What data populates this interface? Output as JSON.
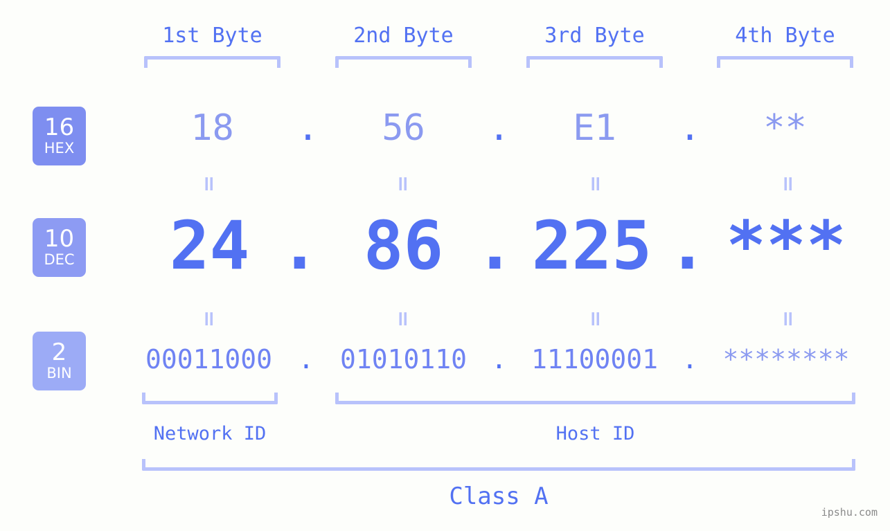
{
  "background_color": "#fdfefb",
  "accent_color": "#5271f2",
  "accent_light_color": "#8b9af0",
  "bracket_color": "#b8c2fb",
  "byte_headers": [
    {
      "label": "1st Byte"
    },
    {
      "label": "2nd Byte"
    },
    {
      "label": "3rd Byte"
    },
    {
      "label": "4th Byte"
    }
  ],
  "radix_badges": [
    {
      "number": "16",
      "word": "HEX",
      "color": "#7e8ef0"
    },
    {
      "number": "10",
      "word": "DEC",
      "color": "#8d9bf3"
    },
    {
      "number": "2",
      "word": "BIN",
      "color": "#9cabf6"
    }
  ],
  "rows": {
    "hex": {
      "radix": "16",
      "values": [
        "18",
        "56",
        "E1",
        "**"
      ],
      "separator": "."
    },
    "dec": {
      "radix": "10",
      "values": [
        "24",
        "86",
        "225",
        "***"
      ],
      "separator": "."
    },
    "bin": {
      "radix": "2",
      "values": [
        "00011000",
        "01010110",
        "11100001",
        "********"
      ],
      "separator": "."
    }
  },
  "equality_marks": {
    "glyph": "=",
    "count": 8
  },
  "sections": [
    {
      "label": "Network ID"
    },
    {
      "label": "Host ID"
    }
  ],
  "class_label": "Class A",
  "watermark": "ipshu.com"
}
